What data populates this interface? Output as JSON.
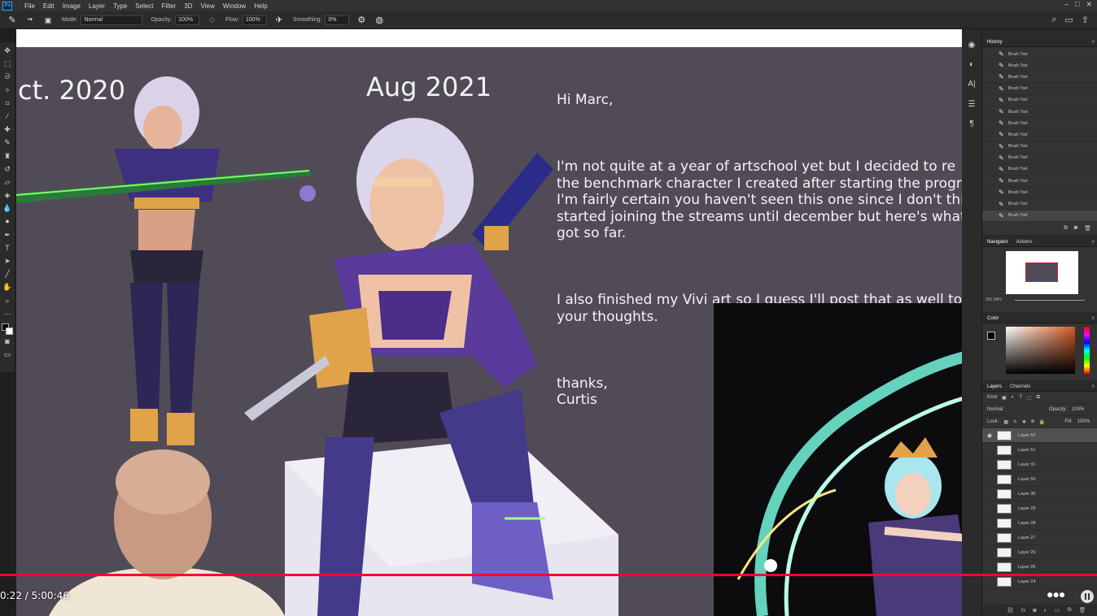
{
  "menubar": {
    "app_icon": "Ps",
    "items": [
      "File",
      "Edit",
      "Image",
      "Layer",
      "Type",
      "Select",
      "Filter",
      "3D",
      "View",
      "Window",
      "Help"
    ]
  },
  "options": {
    "mode_label": "Mode:",
    "mode_value": "Normal",
    "opacity_label": "Opacity:",
    "opacity_value": "100%",
    "flow_label": "Flow:",
    "flow_value": "100%",
    "smoothing_label": "Smoothing:",
    "smoothing_value": "0%"
  },
  "canvas": {
    "label_left": "ct. 2020",
    "label_right": "Aug 2021",
    "letter": {
      "greeting": "Hi Marc,",
      "paragraph1": "I'm not quite at a year of artschool yet but I decided to re\nthe benchmark character I created after starting the progr\nI'm fairly certain you haven't seen this one since I don't think\nstarted joining the streams until december but here's what I'v\ngot so far.",
      "paragraph2": "I also finished my Vivi art so I guess I'll post that as well to g\nyour thoughts.",
      "closing": "thanks,\nCurtis"
    }
  },
  "panels": {
    "history": {
      "title": "History",
      "items": [
        "Brush Tool",
        "Brush Tool",
        "Brush Tool",
        "Brush Tool",
        "Brush Tool",
        "Brush Tool",
        "Brush Tool",
        "Brush Tool",
        "Brush Tool",
        "Brush Tool",
        "Brush Tool",
        "Brush Tool",
        "Brush Tool",
        "Brush Tool",
        "Brush Tool"
      ]
    },
    "navigator": {
      "title": "Navigator",
      "tab2": "Actions",
      "zoom": "201.99%"
    },
    "color": {
      "title": "Color"
    },
    "layers": {
      "title": "Layers",
      "tab2": "Channels",
      "filter": "Kind",
      "blend": "Normal",
      "opacity_label": "Opacity:",
      "opacity_value": "100%",
      "lock_label": "Lock:",
      "fill_label": "Fill:",
      "fill_value": "100%",
      "items": [
        "Layer 52",
        "Layer 51",
        "Layer 31",
        "Layer 50",
        "Layer 30",
        "Layer 29",
        "Layer 28",
        "Layer 27",
        "Layer 26",
        "Layer 25",
        "Layer 24"
      ]
    }
  },
  "player": {
    "time": "0:22 / 5:00:46",
    "progress": 0.001
  }
}
